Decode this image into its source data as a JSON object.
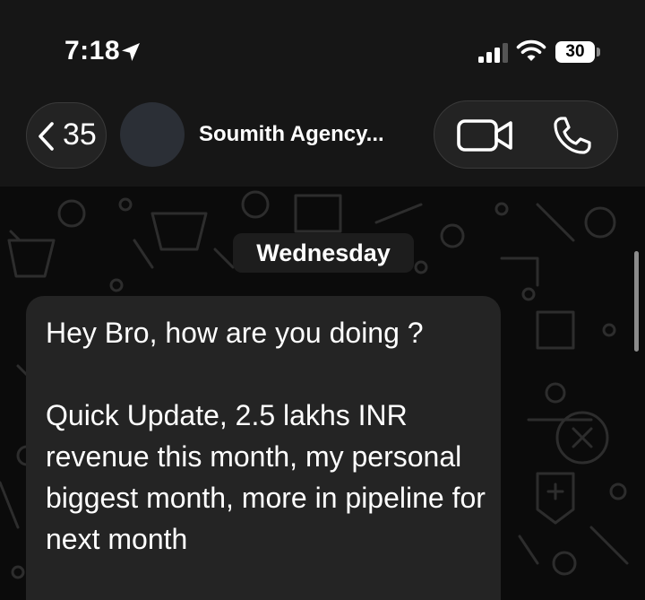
{
  "status_bar": {
    "time": "7:18",
    "battery": "30"
  },
  "header": {
    "back_count": "35",
    "contact_name": "Soumith Agency..."
  },
  "chat": {
    "date_label": "Wednesday",
    "message": {
      "line1": "Hey Bro, how are you doing ?",
      "line2": "Quick Update, 2.5 lakhs INR revenue this month, my personal biggest month, more in pipeline for next month"
    }
  },
  "icons": {
    "location": "location-arrow-icon",
    "signal": "cellular-signal-icon",
    "wifi": "wifi-icon",
    "back": "chevron-left-icon",
    "video": "video-camera-icon",
    "phone": "phone-icon"
  },
  "colors": {
    "background": "#0b0b0b",
    "header": "#161616",
    "bubble": "#242424",
    "text": "#ffffff"
  }
}
